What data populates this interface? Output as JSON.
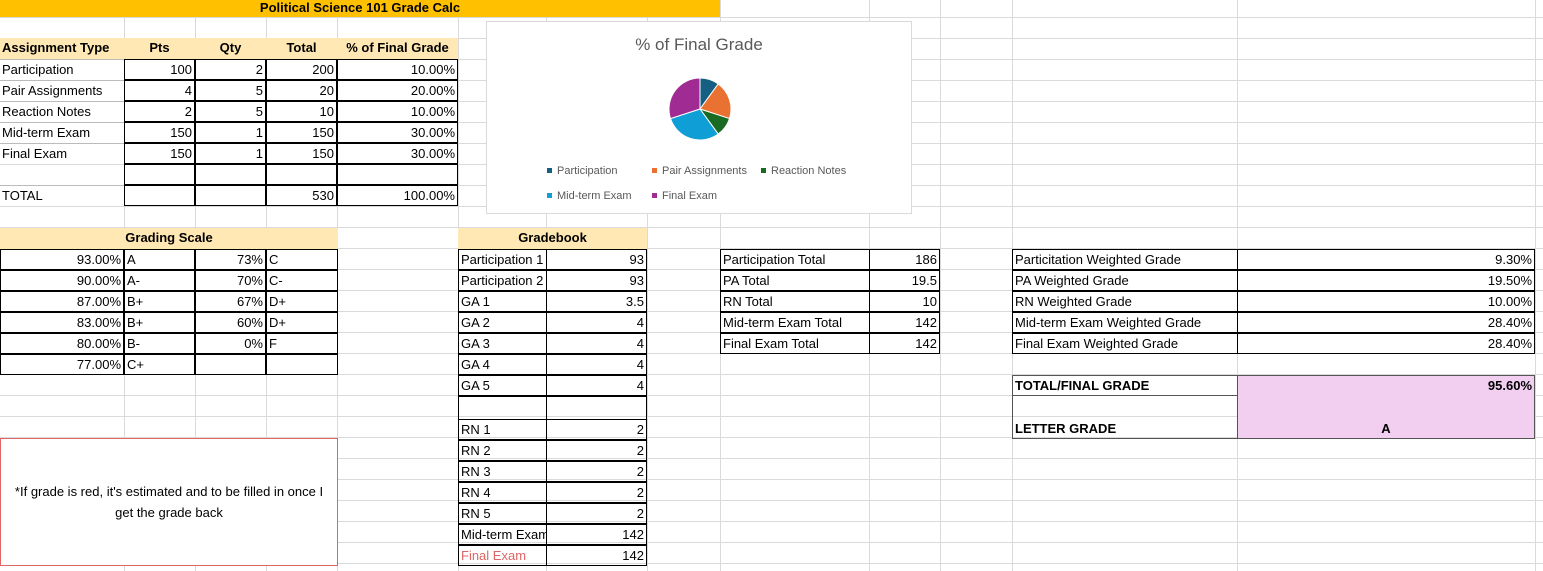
{
  "title": "Political Science 101 Grade Calc",
  "assignments": {
    "headers": [
      "Assignment Type",
      "Pts",
      "Qty",
      "Total",
      "% of Final Grade"
    ],
    "rows": [
      {
        "type": "Participation",
        "pts": "100",
        "qty": "2",
        "total": "200",
        "pct": "10.00%"
      },
      {
        "type": "Pair Assignments",
        "pts": "4",
        "qty": "5",
        "total": "20",
        "pct": "20.00%"
      },
      {
        "type": "Reaction Notes",
        "pts": "2",
        "qty": "5",
        "total": "10",
        "pct": "10.00%"
      },
      {
        "type": "Mid-term Exam",
        "pts": "150",
        "qty": "1",
        "total": "150",
        "pct": "30.00%"
      },
      {
        "type": "Final Exam",
        "pts": "150",
        "qty": "1",
        "total": "150",
        "pct": "30.00%"
      }
    ],
    "total_label": "TOTAL",
    "total_value": "530",
    "total_pct": "100.00%"
  },
  "chart_data": {
    "type": "pie",
    "title": "% of Final Grade",
    "categories": [
      "Participation",
      "Pair Assignments",
      "Reaction Notes",
      "Mid-term Exam",
      "Final Exam"
    ],
    "values": [
      10,
      20,
      10,
      30,
      30
    ],
    "colors": [
      "#156082",
      "#e97132",
      "#196b24",
      "#0f9ed5",
      "#a02b93"
    ],
    "legend_position": "bottom"
  },
  "grading_scale": {
    "title": "Grading Scale",
    "left": [
      {
        "pct": "93.00%",
        "grade": "A"
      },
      {
        "pct": "90.00%",
        "grade": "A-"
      },
      {
        "pct": "87.00%",
        "grade": "B+"
      },
      {
        "pct": "83.00%",
        "grade": "B+"
      },
      {
        "pct": "80.00%",
        "grade": "B-"
      },
      {
        "pct": "77.00%",
        "grade": "C+"
      }
    ],
    "right": [
      {
        "pct": "73%",
        "grade": "C"
      },
      {
        "pct": "70%",
        "grade": "C-"
      },
      {
        "pct": "67%",
        "grade": "D+"
      },
      {
        "pct": "60%",
        "grade": "D+"
      },
      {
        "pct": "0%",
        "grade": "F"
      }
    ]
  },
  "note": "*If grade is red, it's estimated and to be filled in once I get the grade back",
  "gradebook": {
    "title": "Gradebook",
    "group1": [
      {
        "label": "Participation 1",
        "value": "93"
      },
      {
        "label": "Participation 2",
        "value": "93"
      },
      {
        "label": "GA 1",
        "value": "3.5"
      },
      {
        "label": "GA 2",
        "value": "4"
      },
      {
        "label": "GA 3",
        "value": "4"
      },
      {
        "label": "GA 4",
        "value": "4"
      },
      {
        "label": "GA 5",
        "value": "4"
      }
    ],
    "group2": [
      {
        "label": "RN 1",
        "value": "2"
      },
      {
        "label": "RN 2",
        "value": "2"
      },
      {
        "label": "RN 3",
        "value": "2"
      },
      {
        "label": "RN 4",
        "value": "2"
      },
      {
        "label": "RN 5",
        "value": "2"
      },
      {
        "label": "Mid-term Exam",
        "value": "142"
      },
      {
        "label": "Final Exam",
        "value": "142"
      }
    ]
  },
  "totals": [
    {
      "label": "Participation Total",
      "value": "186"
    },
    {
      "label": "PA Total",
      "value": "19.5"
    },
    {
      "label": "RN Total",
      "value": "10"
    },
    {
      "label": "Mid-term Exam Total",
      "value": "142"
    },
    {
      "label": "Final Exam Total",
      "value": "142"
    }
  ],
  "weighted": [
    {
      "label": "Particitation Weighted Grade",
      "value": "9.30%"
    },
    {
      "label": "PA Weighted Grade",
      "value": "19.50%"
    },
    {
      "label": "RN Weighted Grade",
      "value": "10.00%"
    },
    {
      "label": "Mid-term Exam Weighted Grade",
      "value": "28.40%"
    },
    {
      "label": "Final Exam Weighted Grade",
      "value": "28.40%"
    }
  ],
  "final": {
    "total_label": "TOTAL/FINAL GRADE",
    "total_value": "95.60%",
    "letter_label": "LETTER GRADE",
    "letter_value": "A"
  }
}
